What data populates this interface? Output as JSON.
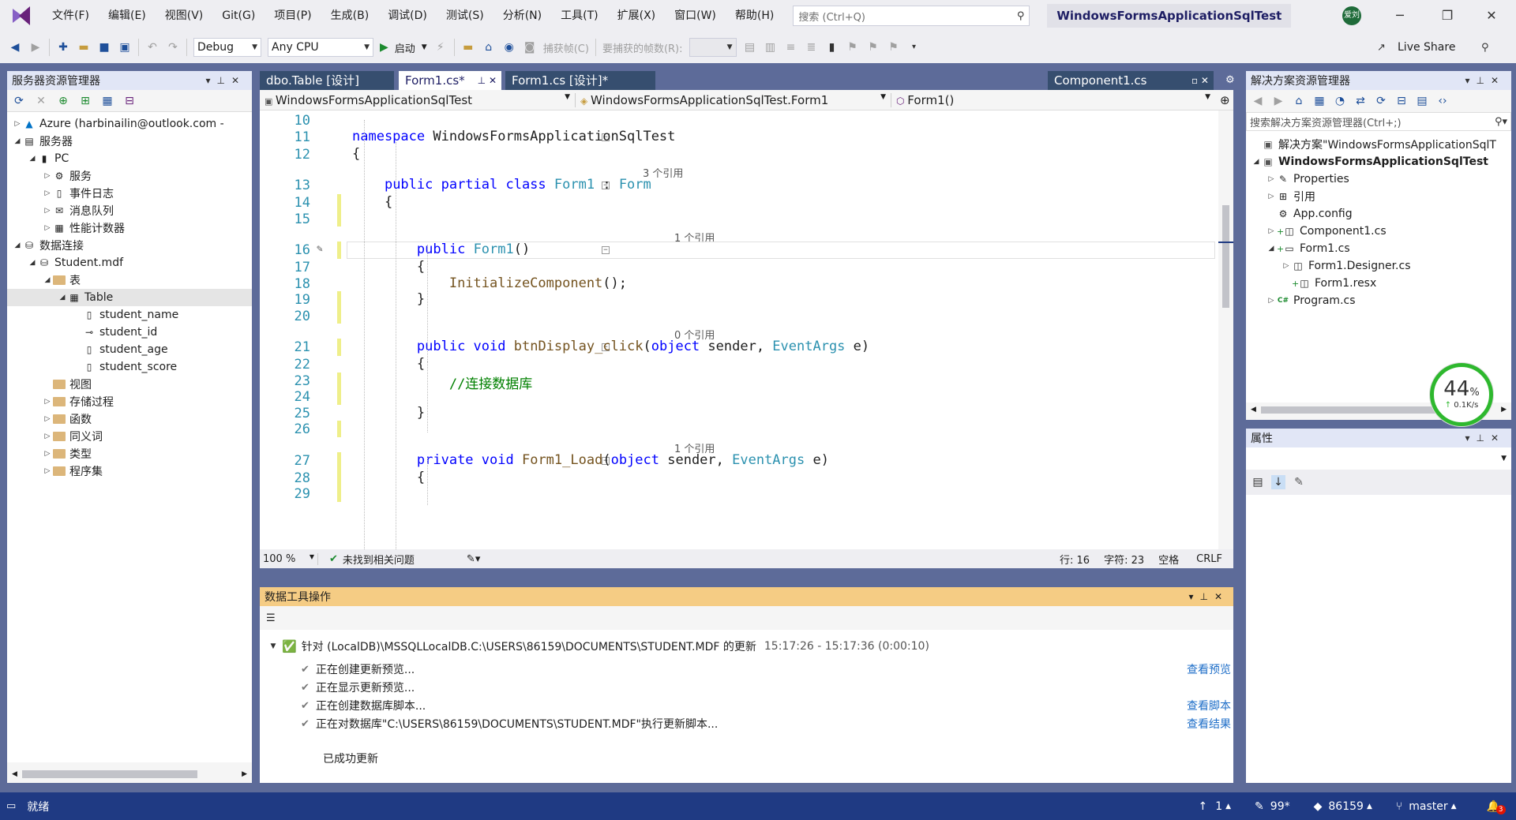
{
  "menu": [
    "文件(F)",
    "编辑(E)",
    "视图(V)",
    "Git(G)",
    "项目(P)",
    "生成(B)",
    "调试(D)",
    "测试(S)",
    "分析(N)",
    "工具(T)",
    "扩展(X)",
    "窗口(W)",
    "帮助(H)"
  ],
  "search": {
    "placeholder": "搜索 (Ctrl+Q)"
  },
  "window_title": "WindowsFormsApplicationSqlTest",
  "avatar_text": "爱刘",
  "toolbar": {
    "config": "Debug",
    "platform": "Any CPU",
    "start": "启动",
    "capture": "捕获帧(C)",
    "frames_label": "要捕获的帧数(R):",
    "live_share": "Live Share"
  },
  "server_explorer": {
    "title": "服务器资源管理器",
    "items": [
      {
        "label": "Azure (harbinailin@outlook.com -",
        "depth": 0,
        "exp": "closed",
        "icon": "azure-icon"
      },
      {
        "label": "服务器",
        "depth": 0,
        "exp": "open",
        "icon": "servers-icon"
      },
      {
        "label": "PC",
        "depth": 1,
        "exp": "open",
        "icon": "pc-icon"
      },
      {
        "label": "服务",
        "depth": 2,
        "exp": "closed",
        "icon": "services-icon"
      },
      {
        "label": "事件日志",
        "depth": 2,
        "exp": "closed",
        "icon": "event-log-icon"
      },
      {
        "label": "消息队列",
        "depth": 2,
        "exp": "closed",
        "icon": "message-queue-icon"
      },
      {
        "label": "性能计数器",
        "depth": 2,
        "exp": "closed",
        "icon": "perf-counter-icon"
      },
      {
        "label": "数据连接",
        "depth": 0,
        "exp": "open",
        "icon": "data-connection-icon"
      },
      {
        "label": "Student.mdf",
        "depth": 1,
        "exp": "open",
        "icon": "database-icon"
      },
      {
        "label": "表",
        "depth": 2,
        "exp": "open",
        "icon": "folder-icon"
      },
      {
        "label": "Table",
        "depth": 3,
        "exp": "open",
        "icon": "table-icon",
        "selected": true
      },
      {
        "label": "student_name",
        "depth": 4,
        "exp": "none",
        "icon": "column-icon"
      },
      {
        "label": "student_id",
        "depth": 4,
        "exp": "none",
        "icon": "key-icon"
      },
      {
        "label": "student_age",
        "depth": 4,
        "exp": "none",
        "icon": "column-icon"
      },
      {
        "label": "student_score",
        "depth": 4,
        "exp": "none",
        "icon": "column-icon"
      },
      {
        "label": "视图",
        "depth": 2,
        "exp": "none",
        "icon": "folder-icon"
      },
      {
        "label": "存储过程",
        "depth": 2,
        "exp": "closed",
        "icon": "folder-icon"
      },
      {
        "label": "函数",
        "depth": 2,
        "exp": "closed",
        "icon": "folder-icon"
      },
      {
        "label": "同义词",
        "depth": 2,
        "exp": "closed",
        "icon": "folder-icon"
      },
      {
        "label": "类型",
        "depth": 2,
        "exp": "closed",
        "icon": "folder-icon"
      },
      {
        "label": "程序集",
        "depth": 2,
        "exp": "closed",
        "icon": "folder-icon"
      }
    ]
  },
  "tabs": [
    {
      "label": "dbo.Table [设计]",
      "active": false
    },
    {
      "label": "Form1.cs*",
      "active": true
    },
    {
      "label": "Form1.cs [设计]*",
      "active": false
    },
    {
      "label": "Component1.cs",
      "active": false
    }
  ],
  "nav": {
    "project": "WindowsFormsApplicationSqlTest",
    "class": "WindowsFormsApplicationSqlTest.Form1",
    "member": "Form1()"
  },
  "code_lines": [
    {
      "n": "10",
      "parts": []
    },
    {
      "n": "11",
      "parts": [
        [
          "kw",
          "namespace"
        ],
        [
          "tx",
          " WindowsFormsApplicationSqlTest"
        ]
      ]
    },
    {
      "n": "12",
      "parts": [
        [
          "tx",
          "{"
        ]
      ]
    },
    {
      "ref": "3 个引用",
      "indent": 1
    },
    {
      "n": "13",
      "parts": [
        [
          "tx",
          "    "
        ],
        [
          "kw",
          "public partial class"
        ],
        [
          "tx",
          " "
        ],
        [
          "ty",
          "Form1"
        ],
        [
          "tx",
          " : "
        ],
        [
          "ty",
          "Form"
        ]
      ]
    },
    {
      "n": "14",
      "parts": [
        [
          "tx",
          "    {"
        ]
      ]
    },
    {
      "n": "15",
      "parts": []
    },
    {
      "ref": "1 个引用",
      "indent": 2
    },
    {
      "n": "16",
      "parts": [
        [
          "tx",
          "        "
        ],
        [
          "kw",
          "public"
        ],
        [
          "tx",
          " "
        ],
        [
          "ty",
          "Form1"
        ],
        [
          "tx",
          "()"
        ]
      ]
    },
    {
      "n": "17",
      "parts": [
        [
          "tx",
          "        {"
        ]
      ]
    },
    {
      "n": "18",
      "parts": [
        [
          "tx",
          "            "
        ],
        [
          "mt",
          "InitializeComponent"
        ],
        [
          "tx",
          "();"
        ]
      ]
    },
    {
      "n": "19",
      "parts": [
        [
          "tx",
          "        }"
        ]
      ]
    },
    {
      "n": "20",
      "parts": []
    },
    {
      "ref": "0 个引用",
      "indent": 2
    },
    {
      "n": "21",
      "parts": [
        [
          "tx",
          "        "
        ],
        [
          "kw",
          "public void"
        ],
        [
          "tx",
          " "
        ],
        [
          "mt",
          "btnDisplay_click"
        ],
        [
          "tx",
          "("
        ],
        [
          "kw",
          "object"
        ],
        [
          "tx",
          " sender, "
        ],
        [
          "ty",
          "EventArgs"
        ],
        [
          "tx",
          " e)"
        ]
      ]
    },
    {
      "n": "22",
      "parts": [
        [
          "tx",
          "        {"
        ]
      ]
    },
    {
      "n": "23",
      "parts": [
        [
          "tx",
          "            "
        ],
        [
          "cm",
          "//连接数据库"
        ]
      ]
    },
    {
      "n": "24",
      "parts": []
    },
    {
      "n": "25",
      "parts": [
        [
          "tx",
          "        }"
        ]
      ]
    },
    {
      "n": "26",
      "parts": []
    },
    {
      "ref": "1 个引用",
      "indent": 2
    },
    {
      "n": "27",
      "parts": [
        [
          "tx",
          "        "
        ],
        [
          "kw",
          "private void"
        ],
        [
          "tx",
          " "
        ],
        [
          "mt",
          "Form1_Load"
        ],
        [
          "tx",
          "("
        ],
        [
          "kw",
          "object"
        ],
        [
          "tx",
          " sender, "
        ],
        [
          "ty",
          "EventArgs"
        ],
        [
          "tx",
          " e)"
        ]
      ]
    },
    {
      "n": "28",
      "parts": [
        [
          "tx",
          "        {"
        ]
      ]
    },
    {
      "n": "29",
      "parts": []
    }
  ],
  "editor_status": {
    "zoom": "100 %",
    "issues": "未找到相关问题",
    "line": "行: 16",
    "char": "字符: 23",
    "spaces": "空格",
    "eol": "CRLF"
  },
  "data_tools": {
    "title": "数据工具操作",
    "header": "针对 (LocalDB)\\MSSQLLocalDB.C:\\USERS\\86159\\DOCUMENTS\\STUDENT.MDF 的更新",
    "time": "15:17:26 - 15:17:36 (0:00:10)",
    "steps": [
      {
        "text": "正在创建更新预览...",
        "link": "查看预览"
      },
      {
        "text": "正在显示更新预览...",
        "link": ""
      },
      {
        "text": "正在创建数据库脚本...",
        "link": "查看脚本"
      },
      {
        "text": "正在对数据库\"C:\\USERS\\86159\\DOCUMENTS\\STUDENT.MDF\"执行更新脚本...",
        "link": "查看结果"
      }
    ],
    "done": "已成功更新"
  },
  "solution_explorer": {
    "title": "解决方案资源管理器",
    "search_placeholder": "搜索解决方案资源管理器(Ctrl+;)",
    "items": [
      {
        "label": "解决方案\"WindowsFormsApplicationSqlT",
        "depth": 0,
        "exp": "none",
        "icon": "solution-icon",
        "bold": false
      },
      {
        "label": "WindowsFormsApplicationSqlTest",
        "depth": 0,
        "exp": "open",
        "icon": "csproj-icon",
        "bold": true
      },
      {
        "label": "Properties",
        "depth": 1,
        "exp": "closed",
        "icon": "wrench-icon"
      },
      {
        "label": "引用",
        "depth": 1,
        "exp": "closed",
        "icon": "references-icon"
      },
      {
        "label": "App.config",
        "depth": 1,
        "exp": "none",
        "icon": "config-icon"
      },
      {
        "label": "Component1.cs",
        "depth": 1,
        "exp": "closed",
        "icon": "component-icon",
        "plus": true
      },
      {
        "label": "Form1.cs",
        "depth": 1,
        "exp": "open",
        "icon": "form-icon",
        "plus": true
      },
      {
        "label": "Form1.Designer.cs",
        "depth": 2,
        "exp": "closed",
        "icon": "designer-icon"
      },
      {
        "label": "Form1.resx",
        "depth": 2,
        "exp": "none",
        "icon": "resx-icon",
        "plus": true
      },
      {
        "label": "Program.cs",
        "depth": 1,
        "exp": "closed",
        "icon": "csharp-file-icon"
      }
    ]
  },
  "net_widget": {
    "percent": "44",
    "unit": "%",
    "rate": "0.1K/s"
  },
  "properties": {
    "title": "属性"
  },
  "status_bar": {
    "ready": "就绪",
    "up": "1",
    "pen": "99*",
    "repo": "86159",
    "branch": "master",
    "notif": "3"
  }
}
